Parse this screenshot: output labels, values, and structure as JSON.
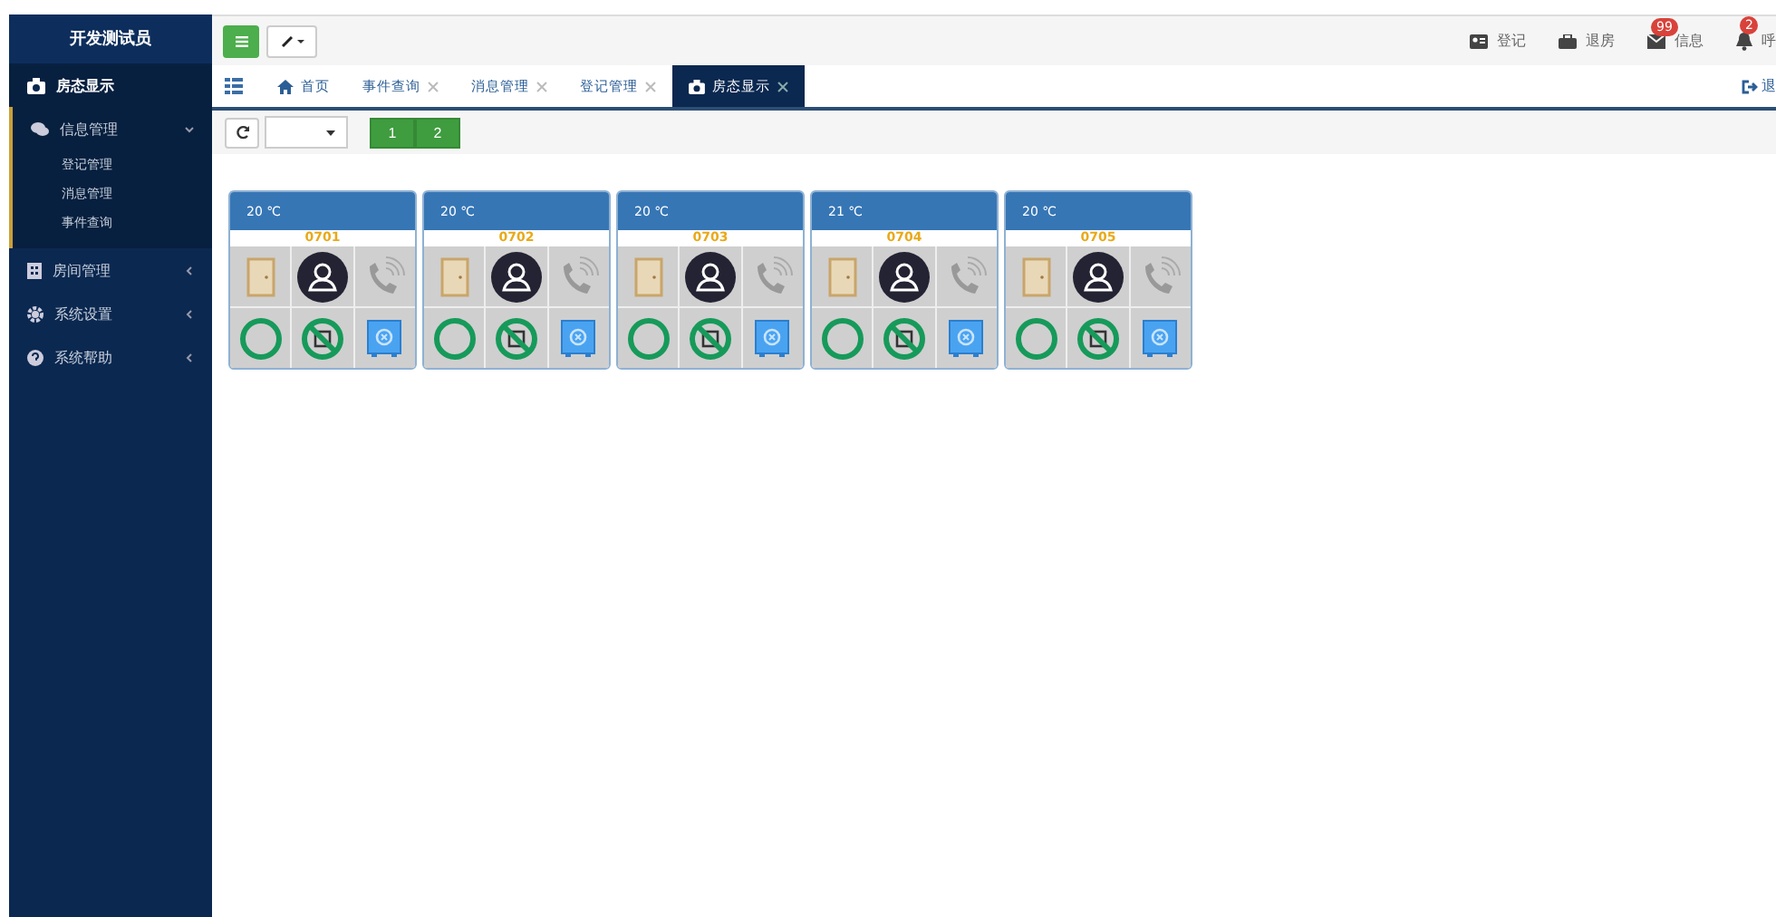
{
  "sidebar": {
    "title": "开发测试员",
    "items": [
      {
        "label": "房态显示",
        "kind": "link",
        "selected": true
      },
      {
        "label": "信息管理",
        "kind": "menu",
        "selected": false,
        "expanded": true,
        "children": [
          {
            "label": "登记管理"
          },
          {
            "label": "消息管理"
          },
          {
            "label": "事件查询"
          }
        ]
      },
      {
        "label": "房间管理",
        "kind": "menu",
        "selected": false,
        "expanded": false
      },
      {
        "label": "系统设置",
        "kind": "menu",
        "selected": false,
        "expanded": false
      },
      {
        "label": "系统帮助",
        "kind": "menu",
        "selected": false,
        "expanded": false
      }
    ]
  },
  "top_actions": [
    {
      "label": "登记"
    },
    {
      "label": "退房"
    },
    {
      "label": "信息",
      "badge": "99"
    },
    {
      "label": "呼",
      "badge": "2"
    }
  ],
  "tabs": [
    {
      "label": "首页",
      "kind": "home",
      "selected": false
    },
    {
      "label": "事件查询",
      "kind": "closable",
      "selected": false
    },
    {
      "label": "消息管理",
      "kind": "closable",
      "selected": false
    },
    {
      "label": "登记管理",
      "kind": "closable",
      "selected": false
    },
    {
      "label": "房态显示",
      "kind": "camera",
      "selected": true
    }
  ],
  "logout": "退",
  "pages": [
    "1",
    "2"
  ],
  "rooms": [
    {
      "temp": "20 ℃",
      "number": "0701"
    },
    {
      "temp": "20 ℃",
      "number": "0702"
    },
    {
      "temp": "20 ℃",
      "number": "0703"
    },
    {
      "temp": "21 ℃",
      "number": "0704"
    },
    {
      "temp": "20 ℃",
      "number": "0705"
    }
  ]
}
